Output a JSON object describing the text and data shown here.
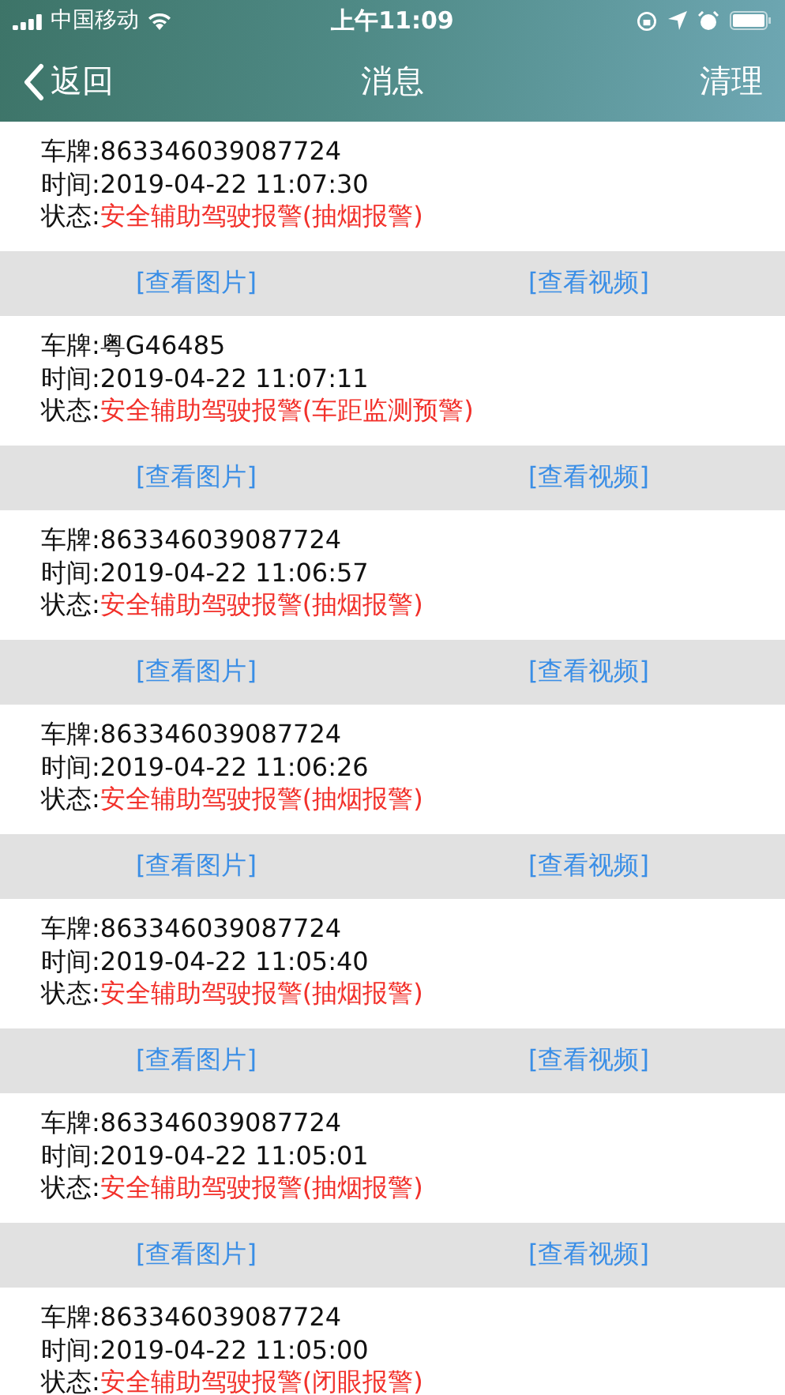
{
  "status_bar": {
    "carrier": "中国移动",
    "time": "上午11:09"
  },
  "nav": {
    "back": "返回",
    "title": "消息",
    "action": "清理"
  },
  "messages": [
    {
      "plate_label": "车牌:",
      "plate": "863346039087724",
      "time_label": "时间:",
      "time": "2019-04-22 11:07:30",
      "status_label": "状态:",
      "status": "安全辅助驾驶报警(抽烟报警)",
      "photo_link": "[查看图片]",
      "video_link": "[查看视频]"
    },
    {
      "plate_label": "车牌:",
      "plate": "粤G46485",
      "time_label": "时间:",
      "time": "2019-04-22 11:07:11",
      "status_label": "状态:",
      "status": "安全辅助驾驶报警(车距监测预警)",
      "photo_link": "[查看图片]",
      "video_link": "[查看视频]"
    },
    {
      "plate_label": "车牌:",
      "plate": "863346039087724",
      "time_label": "时间:",
      "time": "2019-04-22 11:06:57",
      "status_label": "状态:",
      "status": "安全辅助驾驶报警(抽烟报警)",
      "photo_link": "[查看图片]",
      "video_link": "[查看视频]"
    },
    {
      "plate_label": "车牌:",
      "plate": "863346039087724",
      "time_label": "时间:",
      "time": "2019-04-22 11:06:26",
      "status_label": "状态:",
      "status": "安全辅助驾驶报警(抽烟报警)",
      "photo_link": "[查看图片]",
      "video_link": "[查看视频]"
    },
    {
      "plate_label": "车牌:",
      "plate": "863346039087724",
      "time_label": "时间:",
      "time": "2019-04-22 11:05:40",
      "status_label": "状态:",
      "status": "安全辅助驾驶报警(抽烟报警)",
      "photo_link": "[查看图片]",
      "video_link": "[查看视频]"
    },
    {
      "plate_label": "车牌:",
      "plate": "863346039087724",
      "time_label": "时间:",
      "time": "2019-04-22 11:05:01",
      "status_label": "状态:",
      "status": "安全辅助驾驶报警(抽烟报警)",
      "photo_link": "[查看图片]",
      "video_link": "[查看视频]"
    },
    {
      "plate_label": "车牌:",
      "plate": "863346039087724",
      "time_label": "时间:",
      "time": "2019-04-22 11:05:00",
      "status_label": "状态:",
      "status": "安全辅助驾驶报警(闭眼报警)"
    }
  ]
}
